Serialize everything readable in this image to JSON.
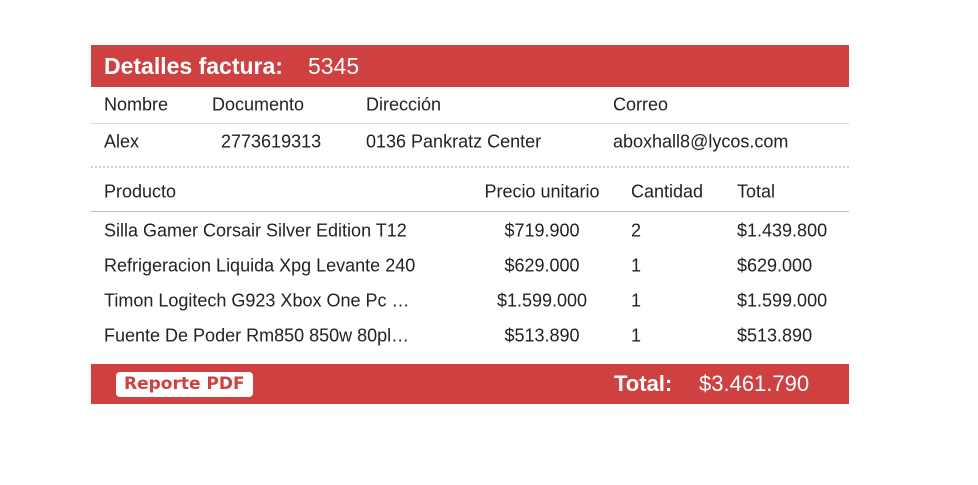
{
  "header": {
    "title": "Detalles factura:",
    "number": "5345"
  },
  "client": {
    "columns": {
      "name": "Nombre",
      "document": "Documento",
      "address": "Dirección",
      "email": "Correo"
    },
    "values": {
      "name": "Alex",
      "document": "2773619313",
      "address": "0136 Pankratz Center",
      "email": "aboxhall8@lycos.com"
    }
  },
  "products": {
    "columns": {
      "product": "Producto",
      "unit_price": "Precio unitario",
      "quantity": "Cantidad",
      "total": "Total"
    },
    "rows": [
      {
        "product": "Silla Gamer Corsair Silver Edition T12",
        "unit_price": "$719.900",
        "quantity": "2",
        "total": "$1.439.800"
      },
      {
        "product": "Refrigeracion Liquida Xpg Levante 240",
        "unit_price": "$629.000",
        "quantity": "1",
        "total": "$629.000"
      },
      {
        "product": "Timon Logitech G923 Xbox One Pc …",
        "unit_price": "$1.599.000",
        "quantity": "1",
        "total": "$1.599.000"
      },
      {
        "product": "Fuente De Poder Rm850 850w 80pl…",
        "unit_price": "$513.890",
        "quantity": "1",
        "total": "$513.890"
      }
    ]
  },
  "footer": {
    "pdf_button_label": "Reporte PDF",
    "total_label": "Total:",
    "total_value": "$3.461.790"
  },
  "colors": {
    "accent": "#cf4141",
    "text": "#222222",
    "background": "#ffffff"
  }
}
